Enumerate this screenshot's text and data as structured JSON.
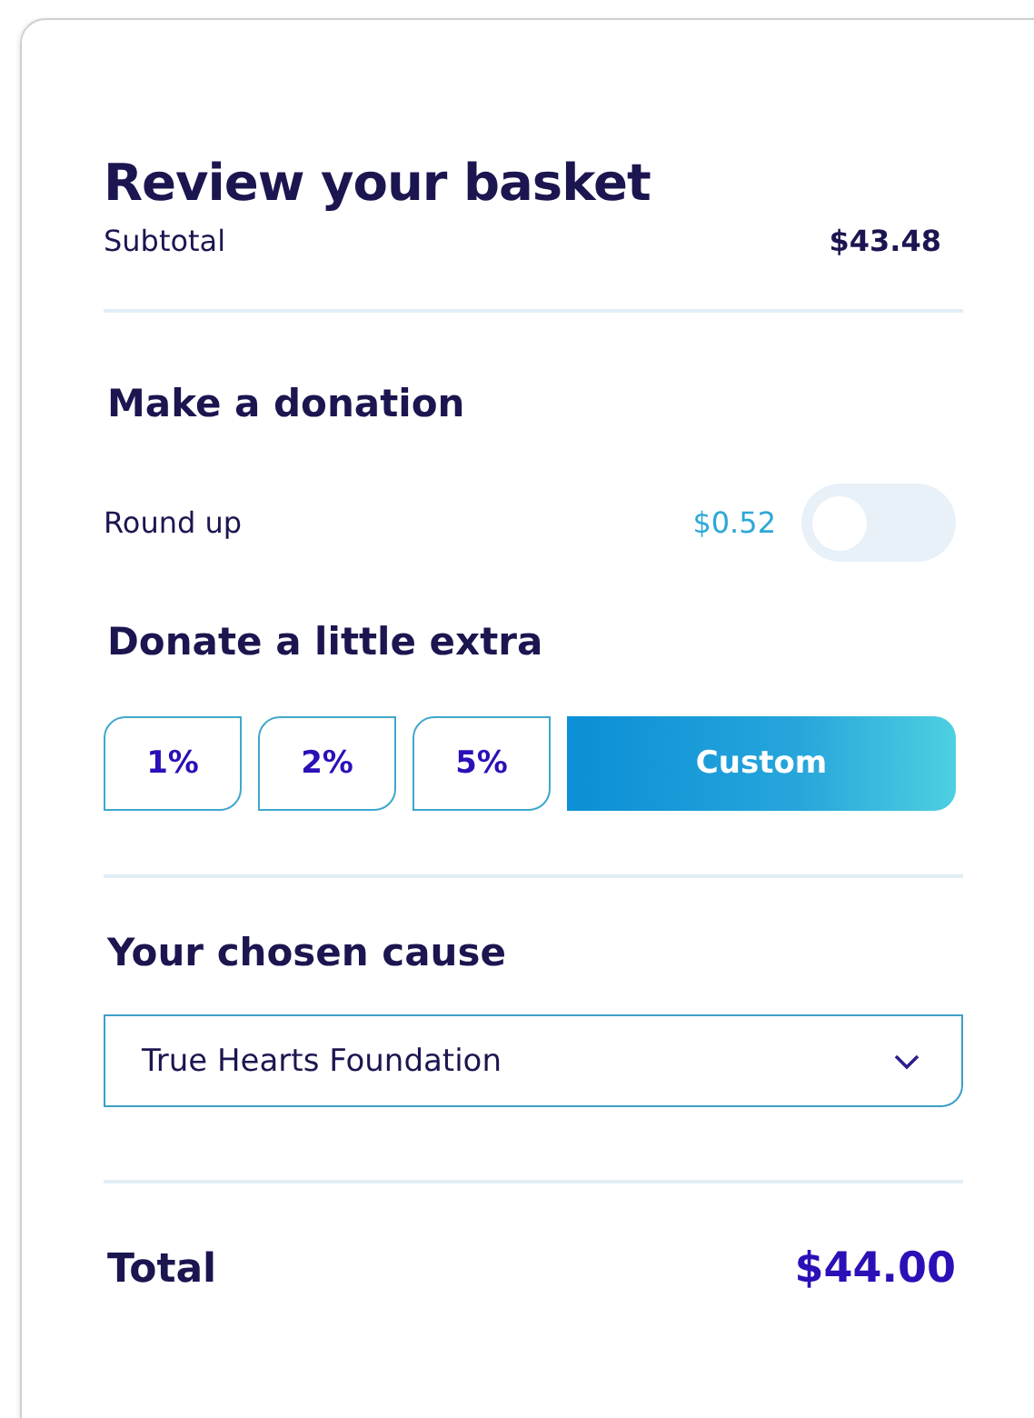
{
  "title": "Review your basket",
  "subtotal": {
    "label": "Subtotal",
    "value": "$43.48"
  },
  "donation": {
    "heading": "Make a donation",
    "round_up": {
      "label": "Round up",
      "amount": "$0.52",
      "on": false
    }
  },
  "extra": {
    "heading": "Donate a little extra",
    "options": [
      {
        "label": "1%",
        "selected": false
      },
      {
        "label": "2%",
        "selected": false
      },
      {
        "label": "5%",
        "selected": false
      },
      {
        "label": "Custom",
        "selected": true
      }
    ]
  },
  "cause": {
    "heading": "Your chosen cause",
    "value": "True Hearts Foundation"
  },
  "total": {
    "label": "Total",
    "value": "$44.00"
  }
}
